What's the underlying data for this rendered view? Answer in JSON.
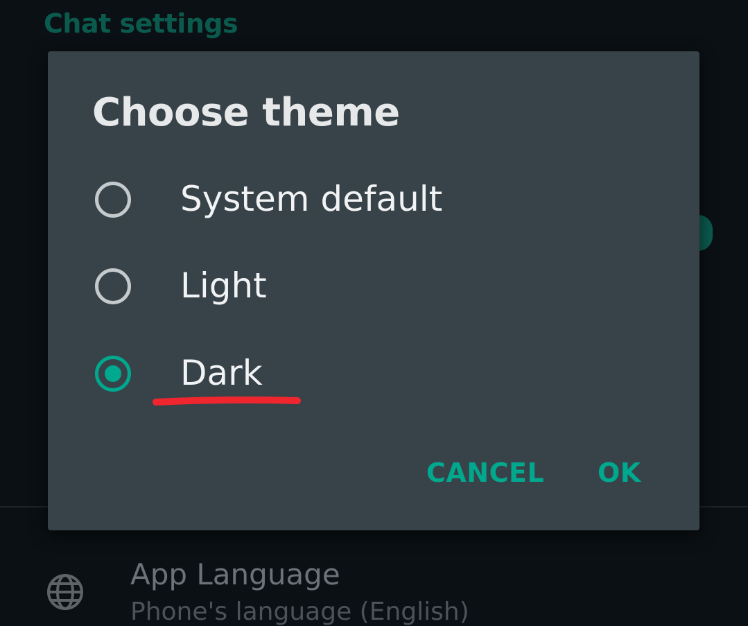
{
  "background": {
    "section_title": "Chat settings",
    "app_language": {
      "icon": "globe-icon",
      "title": "App Language",
      "subtitle": "Phone's language (English)"
    }
  },
  "dialog": {
    "title": "Choose theme",
    "options": [
      {
        "label": "System default",
        "selected": false
      },
      {
        "label": "Light",
        "selected": false
      },
      {
        "label": "Dark",
        "selected": true
      }
    ],
    "cancel_label": "CANCEL",
    "ok_label": "OK"
  },
  "colors": {
    "accent": "#00a88e",
    "dialog_bg": "#384349",
    "screen_bg": "#0b1014",
    "annotation": "#f0262e"
  }
}
